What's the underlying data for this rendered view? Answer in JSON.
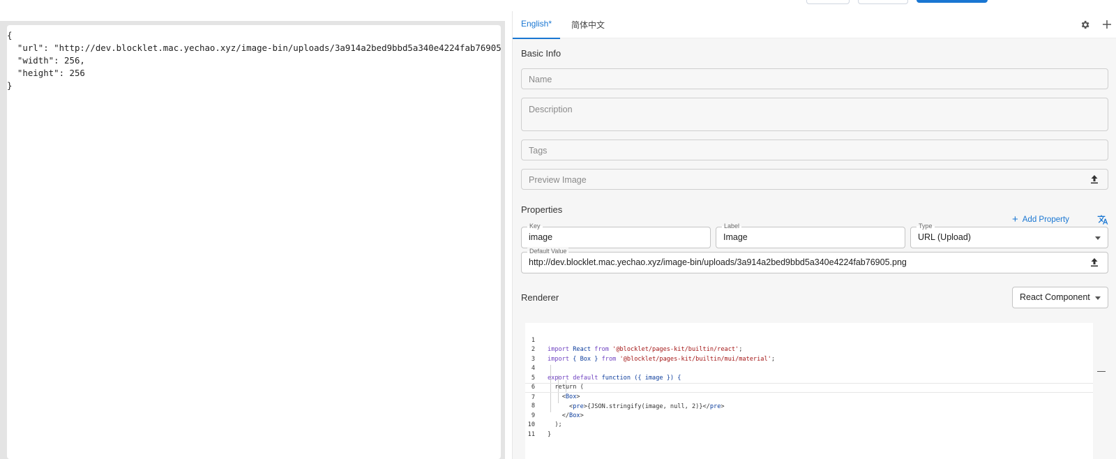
{
  "tabs": {
    "english": "English",
    "english_modified_mark": "*",
    "chinese": "简体中文"
  },
  "preview": {
    "json_lines": [
      "{",
      "  \"url\": \"http://dev.blocklet.mac.yechao.xyz/image-bin/uploads/3a914a2bed9bbd5a340e4224fab76905",
      "  \"width\": 256,",
      "  \"height\": 256",
      "}"
    ]
  },
  "basic_info": {
    "title": "Basic Info",
    "name_placeholder": "Name",
    "description_placeholder": "Description",
    "tags_placeholder": "Tags",
    "preview_image_placeholder": "Preview Image"
  },
  "properties": {
    "title": "Properties",
    "add_property_label": "Add Property",
    "key": {
      "label": "Key",
      "value": "image"
    },
    "label": {
      "label": "Label",
      "value": "Image"
    },
    "type": {
      "label": "Type",
      "value": "URL (Upload)"
    },
    "default_value": {
      "label": "Default Value",
      "value": "http://dev.blocklet.mac.yechao.xyz/image-bin/uploads/3a914a2bed9bbd5a340e4224fab76905.png"
    }
  },
  "renderer": {
    "title": "Renderer",
    "selected": "React Component",
    "code_lines": [
      "1",
      "2",
      "3",
      "4",
      "5",
      "6",
      "7",
      "8",
      "9",
      "10",
      "11"
    ],
    "code": {
      "l1_import": "import",
      "l1_react": " React ",
      "l1_from": "from",
      "l1_str": " '@blocklet/pages-kit/builtin/react'",
      "l1_end": ";",
      "l2_import": "import",
      "l2_box": " { Box } ",
      "l2_from": "from",
      "l2_str": " '@blocklet/pages-kit/builtin/mui/material'",
      "l2_end": ";",
      "l4_export": "export default",
      "l4_function": " function ",
      "l4_args": "({ image }) {",
      "l5": "  return (",
      "l6_open": "    <",
      "l6_tag": "Box",
      "l6_close": ">",
      "l7_open": "      <",
      "l7_tag": "pre",
      "l7_mid": ">{JSON.stringify(image, null, 2)}</",
      "l7_tag2": "pre",
      "l7_close": ">",
      "l8_open": "    </",
      "l8_tag": "Box",
      "l8_close": ">",
      "l9": "  );",
      "l10": "}"
    }
  }
}
